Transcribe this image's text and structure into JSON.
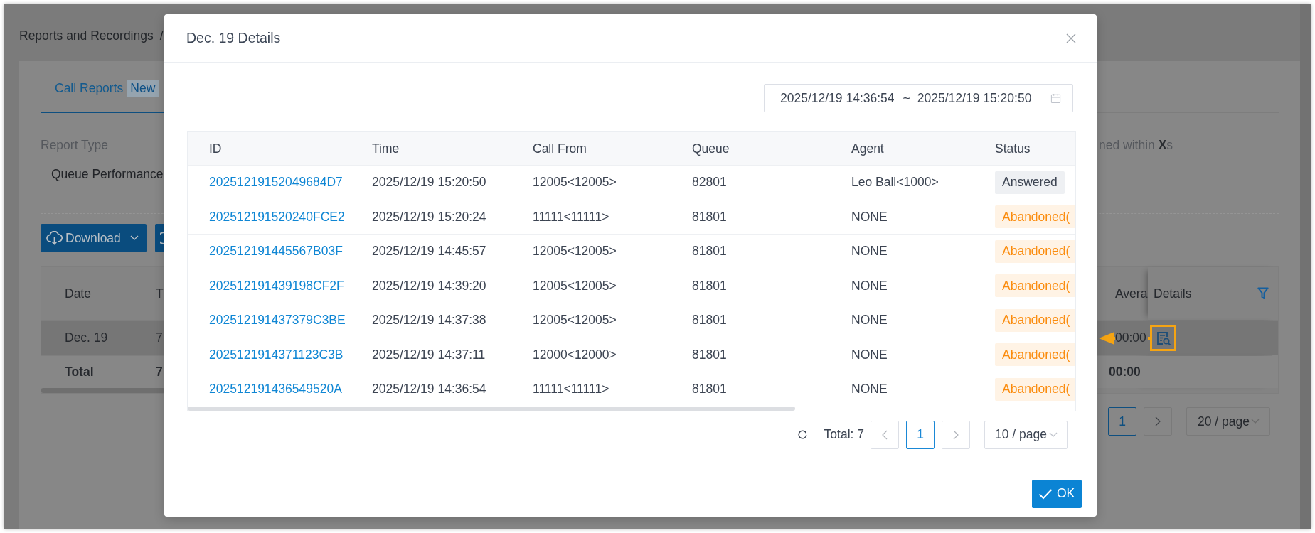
{
  "breadcrumb": {
    "label": "Reports and Recordings",
    "separator": "/"
  },
  "tabs": [
    {
      "label": "Call Reports",
      "badge": "New",
      "selected": true
    }
  ],
  "filters": [
    {
      "label": "Report Type",
      "value": "Queue Performance"
    },
    {
      "label": "ned within **X**s"
    }
  ],
  "toolbar": [
    {
      "kind": "dropdown",
      "label": "Download"
    },
    {
      "kind": "icon"
    }
  ],
  "summary_table": {
    "columns": [
      "Date",
      "T",
      "Avera",
      "Details"
    ],
    "rows": [
      {
        "kind": "data",
        "highlighted": true,
        "cells": [
          "Dec. 19",
          "7",
          "00:00"
        ]
      },
      {
        "kind": "total",
        "highlighted": false,
        "cells": [
          "Total",
          "7",
          "00:00"
        ]
      }
    ]
  },
  "summary_pagination": {
    "pages": [
      {
        "label": "1",
        "selected": true
      }
    ],
    "page_size": "20 / page"
  },
  "dialog": {
    "title": "Dec. 19 Details",
    "date_range": {
      "start": "2025/12/19 14:36:54",
      "separator": "~",
      "end": "2025/12/19 15:20:50"
    },
    "table": {
      "columns": [
        "ID",
        "Time",
        "Call From",
        "Queue",
        "Agent",
        "Status"
      ],
      "rows": [
        {
          "id": "20251219152049684D7",
          "time": "2025/12/19 15:20:50",
          "call_from": "12005<12005>",
          "queue": "82801",
          "agent": "Leo Ball<1000>",
          "status": {
            "kind": "answered",
            "label": "Answered"
          }
        },
        {
          "id": "202512191520240FCE2",
          "time": "2025/12/19 15:20:24",
          "call_from": "11111<11111>",
          "queue": "81801",
          "agent": "NONE",
          "status": {
            "kind": "abandoned",
            "label": "Abandoned("
          }
        },
        {
          "id": "202512191445567B03F",
          "time": "2025/12/19 14:45:57",
          "call_from": "12005<12005>",
          "queue": "81801",
          "agent": "NONE",
          "status": {
            "kind": "abandoned",
            "label": "Abandoned("
          }
        },
        {
          "id": "202512191439198CF2F",
          "time": "2025/12/19 14:39:20",
          "call_from": "12005<12005>",
          "queue": "81801",
          "agent": "NONE",
          "status": {
            "kind": "abandoned",
            "label": "Abandoned("
          }
        },
        {
          "id": "202512191437379C3BE",
          "time": "2025/12/19 14:37:38",
          "call_from": "12005<12005>",
          "queue": "81801",
          "agent": "NONE",
          "status": {
            "kind": "abandoned",
            "label": "Abandoned("
          }
        },
        {
          "id": "2025121914371123C3B",
          "time": "2025/12/19 14:37:11",
          "call_from": "12000<12000>",
          "queue": "81801",
          "agent": "NONE",
          "status": {
            "kind": "abandoned",
            "label": "Abandoned("
          }
        },
        {
          "id": "202512191436549520A",
          "time": "2025/12/19 14:36:54",
          "call_from": "11111<11111>",
          "queue": "81801",
          "agent": "NONE",
          "status": {
            "kind": "abandoned",
            "label": "Abandoned("
          }
        }
      ]
    },
    "pagination": {
      "total": "Total: 7",
      "pages": [
        {
          "label": "1",
          "selected": true
        }
      ],
      "page_size": "10 / page"
    },
    "ok_button": "OK"
  }
}
